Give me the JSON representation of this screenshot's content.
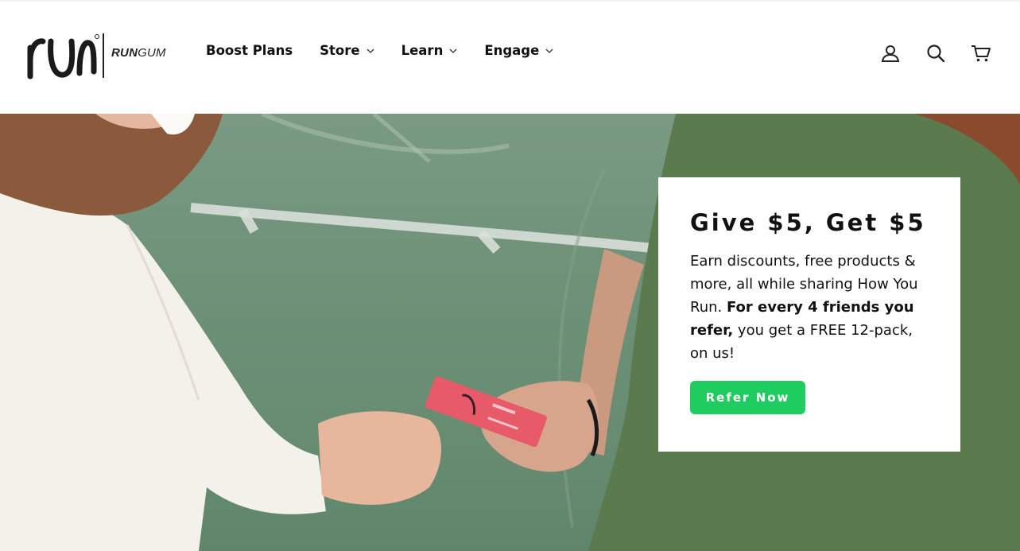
{
  "brand": {
    "logo_word_run": "RUN",
    "logo_word_gum": "GUM",
    "logo_icon": "run-script-logo-icon"
  },
  "nav": {
    "items": [
      {
        "label": "Boost Plans",
        "has_dropdown": false
      },
      {
        "label": "Store",
        "has_dropdown": true
      },
      {
        "label": "Learn",
        "has_dropdown": true
      },
      {
        "label": "Engage",
        "has_dropdown": true
      }
    ]
  },
  "header_icons": [
    "account-icon",
    "search-icon",
    "cart-icon"
  ],
  "promo": {
    "title": "Give $5, Get $5",
    "body_intro": "Earn discounts, free products & more, all while sharing How You Run. ",
    "body_bold": "For every 4 friends you refer,",
    "body_rest": " you get a FREE 12-pack, on us!",
    "cta_label": "Refer Now"
  },
  "colors": {
    "cta": "#1fcc5f",
    "hero_green": "#6f9279",
    "text": "#111111"
  }
}
